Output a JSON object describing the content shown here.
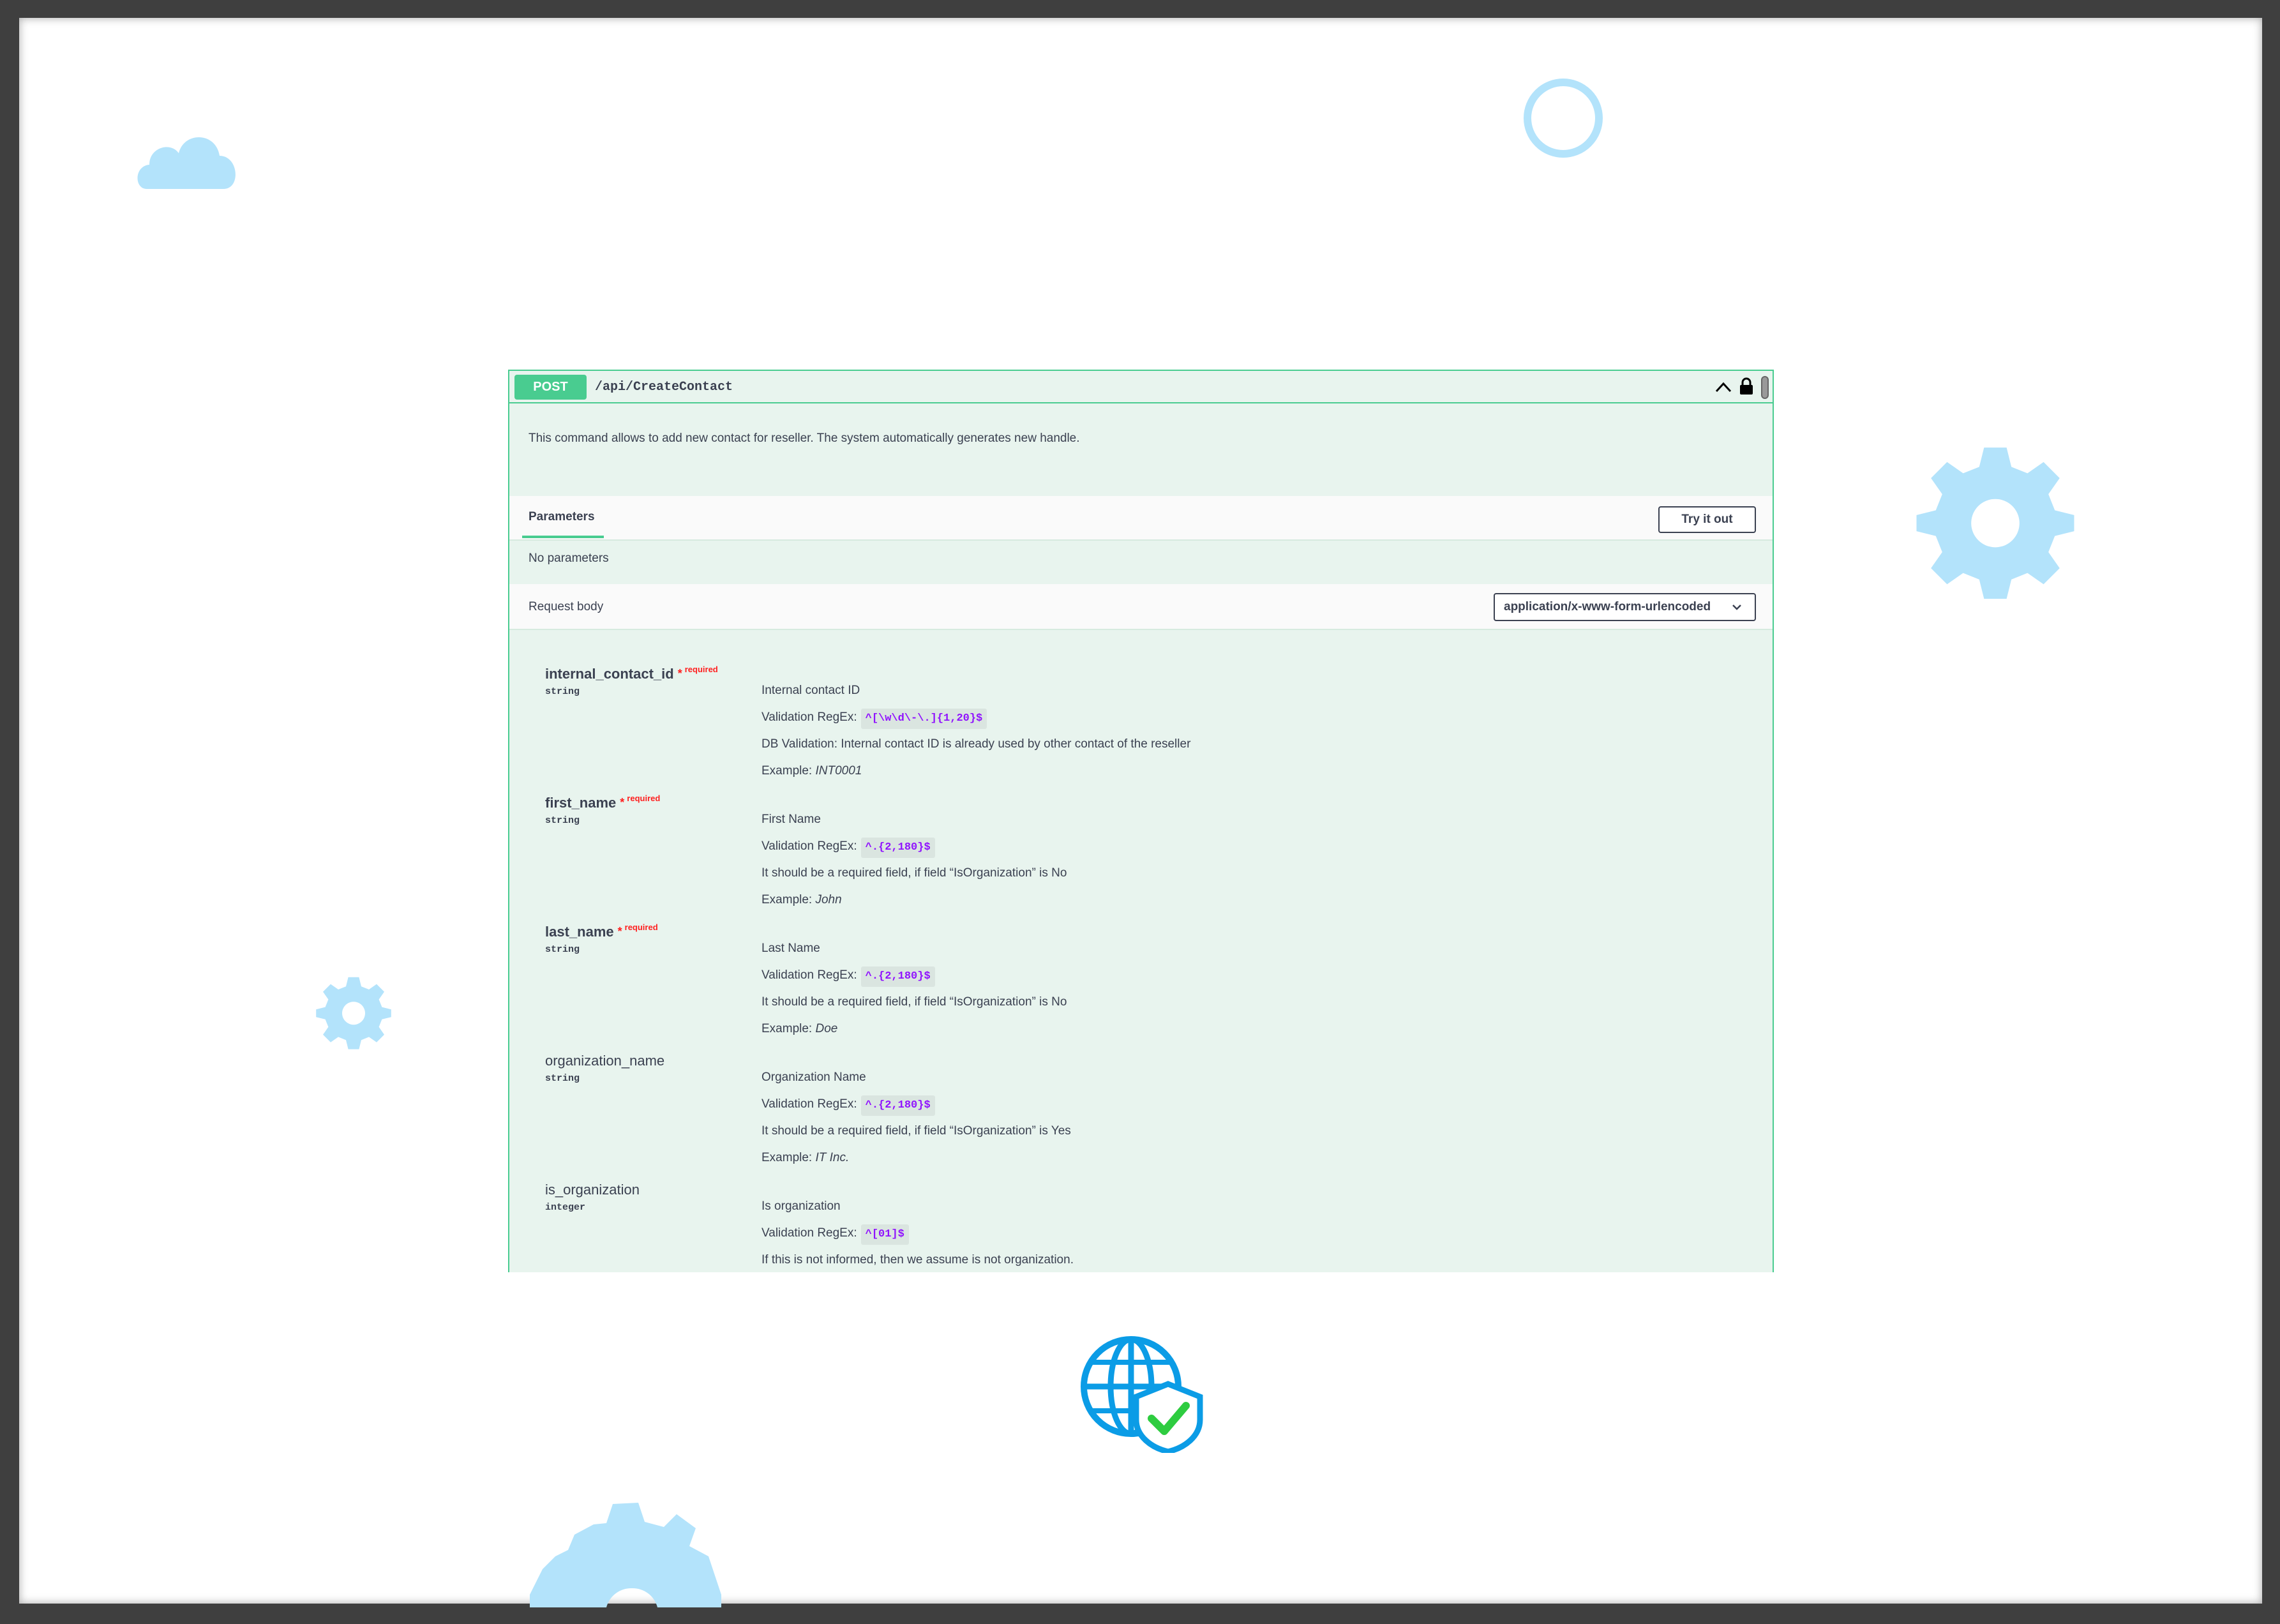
{
  "colors": {
    "post_method": "#49cc90",
    "panel_bg": "#e8f4ee",
    "required": "#ff2020",
    "regex": "#9012fe",
    "decor_blue": "#b3e3fb",
    "globe_blue": "#0b9ce6",
    "check_green": "#2ecc40"
  },
  "operation": {
    "method": "POST",
    "path": "/api/CreateContact",
    "summary": "This command allows to add new contact for reseller. The system automatically generates new handle."
  },
  "parameters": {
    "tab_label": "Parameters",
    "try_button": "Try it out",
    "empty_text": "No parameters"
  },
  "request_body": {
    "label": "Request body",
    "content_type": "application/x-www-form-urlencoded",
    "fields": [
      {
        "name": "internal_contact_id",
        "required": true,
        "type": "string",
        "description": "Internal contact ID",
        "regex_label": "Validation RegEx:",
        "regex": "^[\\w\\d\\-\\.]{1,20}$",
        "note": "DB Validation: Internal contact ID is already used by other contact of the reseller",
        "example_label": "Example:",
        "example": "INT0001"
      },
      {
        "name": "first_name",
        "required": true,
        "type": "string",
        "description": "First Name",
        "regex_label": "Validation RegEx:",
        "regex": "^.{2,180}$",
        "note": "It should be a required field, if field “IsOrganization” is No",
        "example_label": "Example:",
        "example": "John"
      },
      {
        "name": "last_name",
        "required": true,
        "type": "string",
        "description": "Last Name",
        "regex_label": "Validation RegEx:",
        "regex": "^.{2,180}$",
        "note": "It should be a required field, if field “IsOrganization” is No",
        "example_label": "Example:",
        "example": "Doe"
      },
      {
        "name": "organization_name",
        "required": false,
        "type": "string",
        "description": "Organization Name",
        "regex_label": "Validation RegEx:",
        "regex": "^.{2,180}$",
        "note": "It should be a required field, if field “IsOrganization” is Yes",
        "example_label": "Example:",
        "example": "IT Inc."
      },
      {
        "name": "is_organization",
        "required": false,
        "type": "integer",
        "description": "Is organization",
        "regex_label": "Validation RegEx:",
        "regex": "^[01]$",
        "note": "If this is not informed, then we assume is not organization.",
        "example_label": "",
        "example": ""
      }
    ],
    "required_star": "*",
    "required_text": "required"
  },
  "icons": {
    "collapse": "chevron-up-icon",
    "lock": "lock-icon",
    "select": "chevron-down-icon",
    "decorations": [
      "cloud-icon",
      "ring-icon",
      "gear-icon",
      "gear-icon",
      "globe-shield-icon",
      "gear-icon"
    ]
  }
}
